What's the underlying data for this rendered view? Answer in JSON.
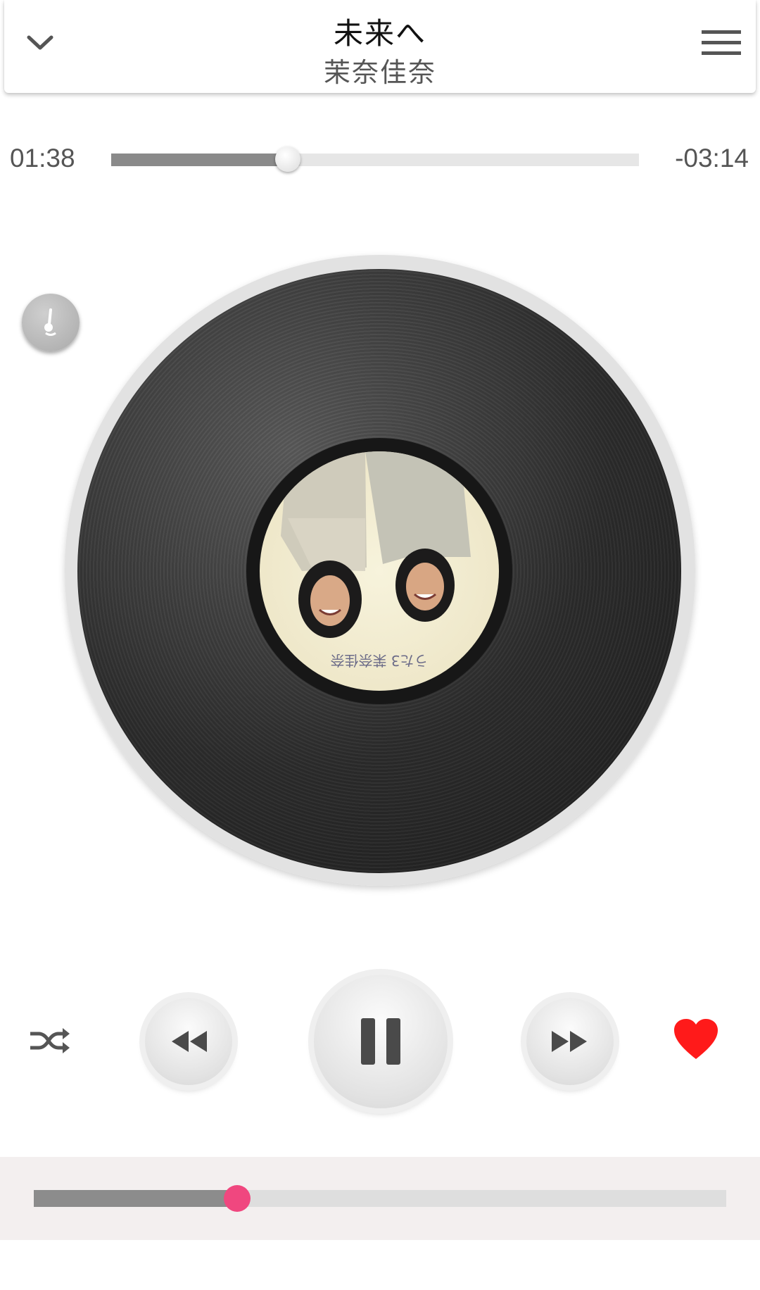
{
  "track": {
    "title": "未来へ",
    "artist": "茉奈佳奈"
  },
  "progress": {
    "elapsed": "01:38",
    "remaining": "-03:14",
    "fraction": 0.335
  },
  "volume": {
    "fraction": 0.294
  },
  "icons": {
    "collapse": "chevron-down-icon",
    "menu": "hamburger-menu-icon",
    "tone": "metronome-icon",
    "shuffle": "shuffle-icon",
    "previous": "rewind-icon",
    "play_pause": "pause-icon",
    "next": "fast-forward-icon",
    "favorite": "heart-icon"
  },
  "colors": {
    "favorite": "#ff1a1a",
    "volume_thumb": "#f0477f",
    "progress_fill": "#8a8a8a"
  },
  "album_art": {
    "caption": "うた3 茉奈佳奈"
  }
}
